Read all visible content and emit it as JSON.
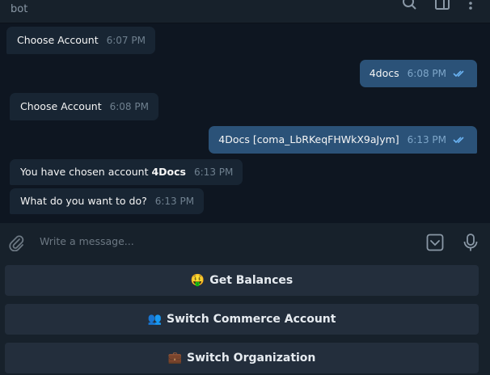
{
  "header": {
    "status": "bot",
    "icons": [
      "search-icon",
      "sidebar-toggle-icon",
      "more-vertical-icon"
    ]
  },
  "messages": [
    {
      "direction": "in",
      "text": "Choose Account",
      "time": "6:07 PM"
    },
    {
      "direction": "out",
      "text": "4docs",
      "time": "6:08 PM",
      "read": true
    },
    {
      "direction": "in",
      "text": "Choose Account",
      "time": "6:08 PM"
    },
    {
      "direction": "out",
      "text": "4Docs [coma_LbRKeqFHWkX9aJym]",
      "time": "6:13 PM",
      "read": true
    },
    {
      "direction": "in",
      "text_prefix": "You have chosen account ",
      "text_bold": "4Docs",
      "time": "6:13 PM"
    },
    {
      "direction": "in",
      "text": "What do you want to do?",
      "time": "6:13 PM"
    }
  ],
  "composer": {
    "placeholder": "Write a message...",
    "icons": [
      "attach-icon",
      "keyboard-toggle-icon",
      "microphone-icon"
    ]
  },
  "keyboard": [
    {
      "emoji": "🤑",
      "label": "Get Balances"
    },
    {
      "emoji": "👥",
      "label": "Switch Commerce Account"
    },
    {
      "emoji": "💼",
      "label": "Switch Organization"
    }
  ],
  "colors": {
    "background": "#0e1621",
    "panel": "#17212b",
    "incoming_bubble": "#182533",
    "outgoing_bubble": "#2b5278",
    "read_check": "#6ab2f2",
    "button": "#232e3c"
  }
}
